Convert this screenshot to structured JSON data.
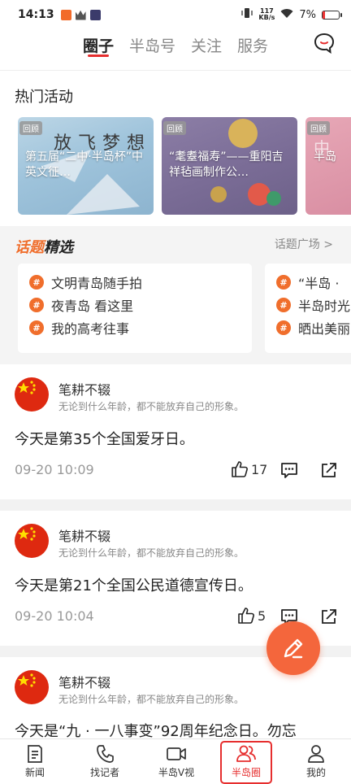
{
  "status_bar": {
    "time": "14:13",
    "network_speed_top": "117",
    "network_speed_unit": "KB/s",
    "battery": "7%"
  },
  "top_nav": {
    "tabs": [
      {
        "label": "圈子",
        "active": true
      },
      {
        "label": "半岛号",
        "active": false
      },
      {
        "label": "关注",
        "active": false
      },
      {
        "label": "服务",
        "active": false
      }
    ]
  },
  "hot_activities": {
    "title": "热门活动",
    "items": [
      {
        "badge": "回顾",
        "text": "第五届“二中·半岛杯”中英文征…",
        "bg_text": "放飞梦想"
      },
      {
        "badge": "回顾",
        "text": "“耄耋福寿”——重阳吉祥毡画制作公…"
      },
      {
        "badge": "回顾",
        "text": "半岛",
        "bg_text": "中"
      }
    ]
  },
  "topics": {
    "logo_a": "话题",
    "logo_b": "精选",
    "square_link": "话题广场 >",
    "cards": [
      {
        "items": [
          "文明青岛随手拍",
          "夜青岛 看这里",
          "我的高考往事"
        ]
      },
      {
        "items": [
          "“半岛 ·",
          "半岛时光",
          "晒出美丽"
        ]
      }
    ]
  },
  "posts": [
    {
      "user": "笔耕不辍",
      "signature": "无论到什么年龄，都不能放弃自己的形象。",
      "text": "今天是第35个全国爱牙日。",
      "time": "09-20 10:09",
      "likes": "17"
    },
    {
      "user": "笔耕不辍",
      "signature": "无论到什么年龄，都不能放弃自己的形象。",
      "text": "今天是第21个全国公民道德宣传日。",
      "time": "09-20 10:04",
      "likes": "5"
    },
    {
      "user": "笔耕不辍",
      "signature": "无论到什么年龄，都不能放弃自己的形象。",
      "text": "今天是“九 · 一八事变”92周年纪念日。勿忘"
    }
  ],
  "bottom_nav": {
    "items": [
      {
        "label": "新闻",
        "icon": "news-icon"
      },
      {
        "label": "找记者",
        "icon": "phone-icon"
      },
      {
        "label": "半岛V视",
        "icon": "video-icon"
      },
      {
        "label": "半岛圈",
        "icon": "people-icon",
        "active": true
      },
      {
        "label": "我的",
        "icon": "user-icon"
      }
    ]
  },
  "colors": {
    "accent": "#e62e2e",
    "topic_orange": "#f06e2c",
    "fab": "#f4663c"
  }
}
